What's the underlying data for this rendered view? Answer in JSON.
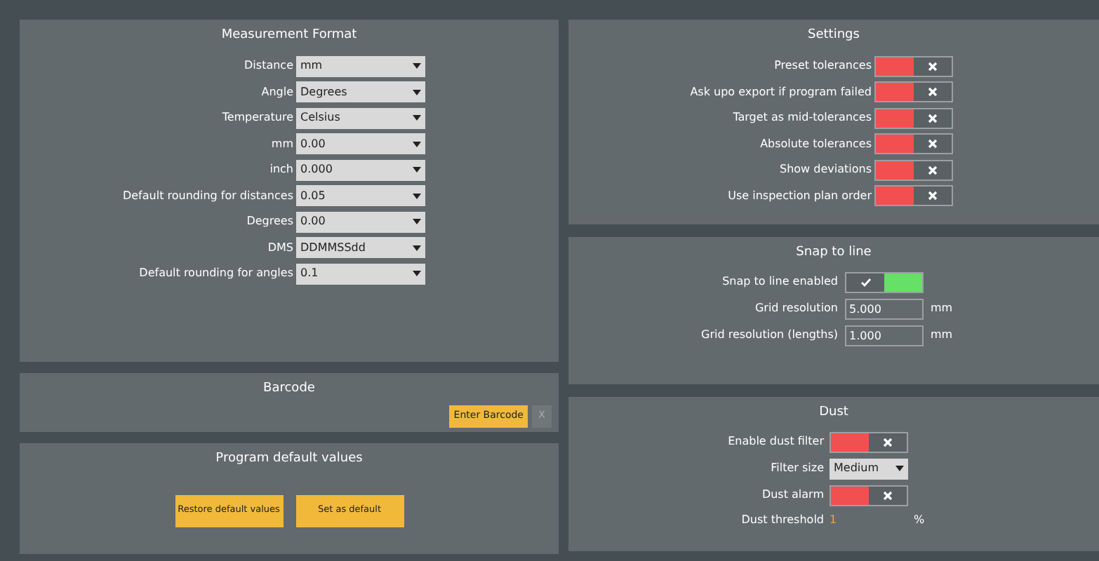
{
  "measurement_format": {
    "title": "Measurement Format",
    "rows": [
      {
        "label": "Distance",
        "value": "mm"
      },
      {
        "label": "Angle",
        "value": "Degrees"
      },
      {
        "label": "Temperature",
        "value": "Celsius"
      },
      {
        "label": "mm",
        "value": "0.00"
      },
      {
        "label": "inch",
        "value": "0.000"
      },
      {
        "label": "Default rounding for distances",
        "value": "0.05"
      },
      {
        "label": "Degrees",
        "value": "0.00"
      },
      {
        "label": "DMS",
        "value": "DDMMSSdd"
      },
      {
        "label": "Default rounding for angles",
        "value": "0.1"
      }
    ]
  },
  "barcode": {
    "title": "Barcode",
    "enter_button": "Enter Barcode",
    "clear_button": "X"
  },
  "program_defaults": {
    "title": "Program default values",
    "buttons": [
      "Restore default values",
      "Set as default"
    ]
  },
  "settings": {
    "title": "Settings",
    "rows": [
      {
        "label": "Preset tolerances",
        "on": false
      },
      {
        "label": "Ask upo export if program failed",
        "on": false
      },
      {
        "label": "Target as mid-tolerances",
        "on": false
      },
      {
        "label": "Absolute tolerances",
        "on": false
      },
      {
        "label": "Show deviations",
        "on": false
      },
      {
        "label": "Use inspection plan order",
        "on": false
      }
    ]
  },
  "snap_to_line": {
    "title": "Snap to line",
    "rows": [
      {
        "kind": "toggle",
        "label": "Snap to line enabled",
        "on": true
      },
      {
        "kind": "field",
        "label": "Grid resolution",
        "value": "5.000",
        "unit": "mm"
      },
      {
        "kind": "field",
        "label": "Grid resolution (lengths)",
        "value": "1.000",
        "unit": "mm"
      }
    ]
  },
  "dust": {
    "title": "Dust",
    "rows": [
      {
        "kind": "toggle",
        "label": "Enable dust filter",
        "on": false
      },
      {
        "kind": "select",
        "label": "Filter size",
        "value": "Medium"
      },
      {
        "kind": "toggle",
        "label": "Dust alarm",
        "on": false
      },
      {
        "kind": "number",
        "label": "Dust threshold",
        "value": "1",
        "unit": "%"
      }
    ]
  }
}
